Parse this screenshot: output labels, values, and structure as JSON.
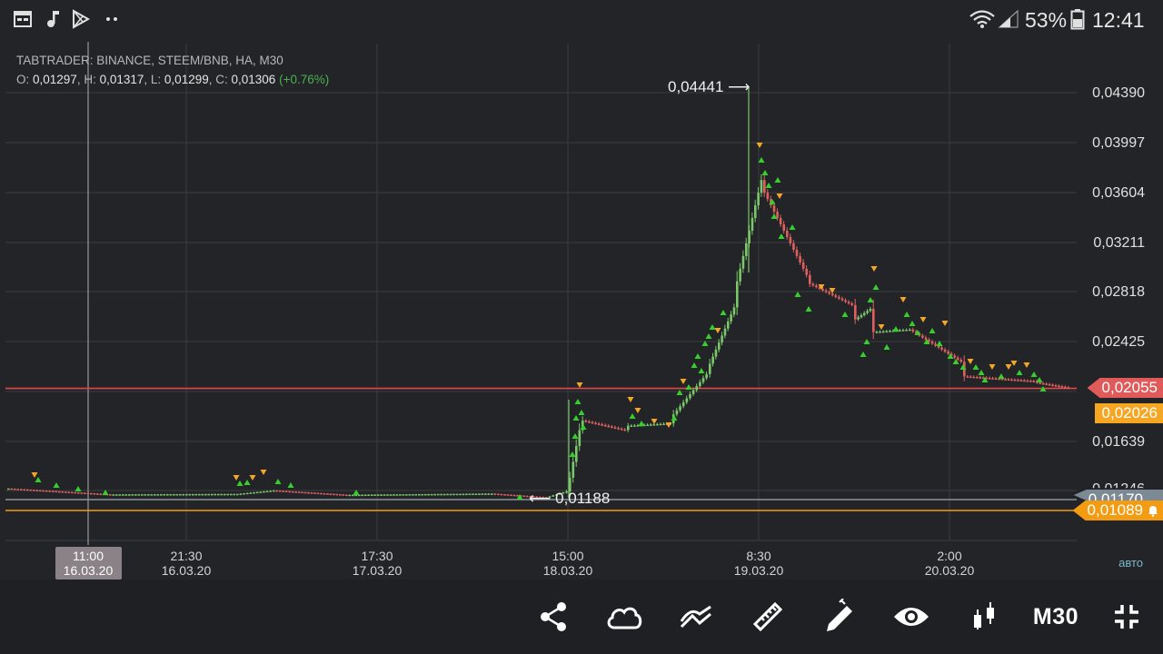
{
  "status_bar": {
    "battery": "53%",
    "time": "12:41",
    "icons": [
      "calendar-icon",
      "music-note-icon",
      "play-store-icon",
      "more-dots-icon",
      "wifi-icon",
      "signal-icon",
      "battery-icon"
    ]
  },
  "chart_header": {
    "line1": "TABTRADER: BINANCE, STEEM/BNB, HA, M30",
    "o_label": "O: ",
    "o": "0,01297",
    "h_label": ", H: ",
    "h": "0,01317",
    "l_label": ", L: ",
    "l": "0,01299",
    "c_label": ", C: ",
    "c": "0,01306",
    "change": "(+0.76%)"
  },
  "colors": {
    "up": "#7bc86a",
    "down": "#e06060",
    "marker_up": "#35d12b",
    "marker_down": "#f5a623",
    "price_line": "#e04848",
    "alert_line": "#f39c12",
    "grey_line": "#8a949b"
  },
  "chart_data": {
    "type": "candlestick",
    "y_ticks": [
      "0,04390",
      "0,03997",
      "0,03604",
      "0,03211",
      "0,02818",
      "0,02425",
      "0,01639",
      "0,01246"
    ],
    "x_ticks": [
      {
        "time": "11:00",
        "date": "16.03.20",
        "highlighted": true
      },
      {
        "time": "21:30",
        "date": "16.03.20"
      },
      {
        "time": "17:30",
        "date": "17.03.20"
      },
      {
        "time": "15:00",
        "date": "18.03.20"
      },
      {
        "time": "8:30",
        "date": "19.03.20"
      },
      {
        "time": "2:00",
        "date": "20.03.20"
      }
    ],
    "max_label": "0,04441",
    "min_label": "0,01188",
    "last_price": "0,02055",
    "alert_price": "0,02026",
    "grey_alert": "0,01170",
    "orange_alert": "0,01089",
    "ylim": [
      0.0098,
      0.0462
    ]
  },
  "toolbar": {
    "interval": "M30",
    "auto": "авто",
    "buttons": [
      "share-icon",
      "cloud-icon",
      "indicators-icon",
      "ruler-icon",
      "pencil-icon",
      "eye-icon",
      "candles-icon",
      "fullscreen-exit-icon"
    ]
  }
}
